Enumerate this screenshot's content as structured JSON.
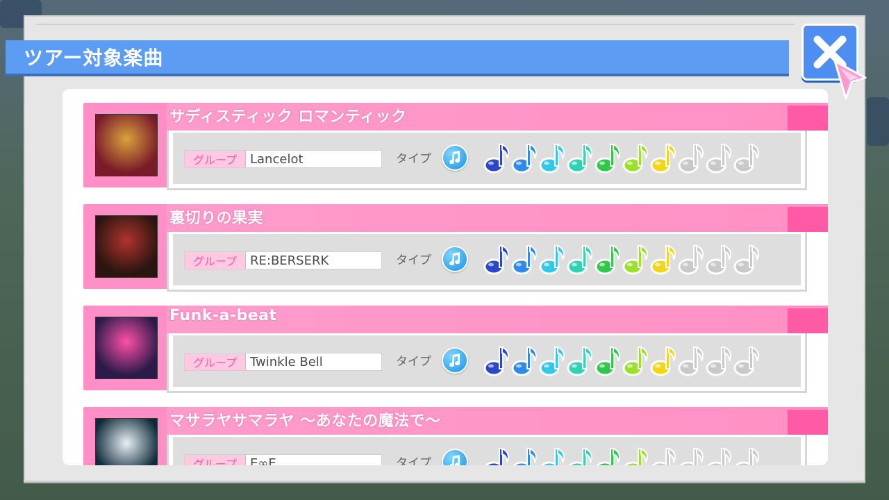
{
  "dialog": {
    "title": "ツアー対象楽曲",
    "close_icon": "close-x-icon"
  },
  "field_labels": {
    "group": "グループ",
    "type": "タイプ"
  },
  "songs": [
    {
      "title": "サディスティック ロマンティック",
      "group": "Lancelot",
      "type_icon": "music-note-icon",
      "difficulty_total": 10,
      "difficulty_level": 7,
      "jacket_colors": [
        "#7a1b2a",
        "#d9a23b"
      ]
    },
    {
      "title": "裏切りの果実",
      "group": "RE:BERSERK",
      "type_icon": "music-note-icon",
      "difficulty_total": 10,
      "difficulty_level": 7,
      "jacket_colors": [
        "#2a1510",
        "#b1332e"
      ]
    },
    {
      "title": "Funk-a-beat",
      "group": "Twinkle Bell",
      "type_icon": "music-note-icon",
      "difficulty_total": 10,
      "difficulty_level": 7,
      "jacket_colors": [
        "#2b1b4a",
        "#ff4fa8"
      ]
    },
    {
      "title": "マサラヤサマラヤ ～あなたの魔法で～",
      "group": "E∞E",
      "type_icon": "music-note-icon",
      "difficulty_total": 10,
      "difficulty_level": 6,
      "jacket_colors": [
        "#0f2a3a",
        "#e8f0f5"
      ]
    }
  ],
  "note_colors": [
    "#2a46c9",
    "#2f8be8",
    "#33c9e6",
    "#2fd3b4",
    "#2ec84a",
    "#9be02b",
    "#f2d61b",
    "#c9c9c9",
    "#c9c9c9",
    "#c9c9c9"
  ],
  "theme": {
    "title_bar": "#5c9cf3",
    "song_pink": "#ff8fc6",
    "song_pink_dark": "#ff5aa6"
  }
}
